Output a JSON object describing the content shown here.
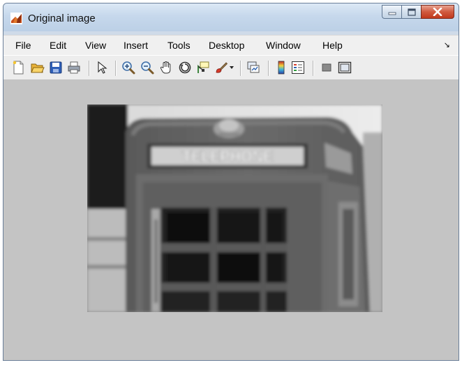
{
  "window": {
    "title": "Original image",
    "accent": "#4a79b8"
  },
  "titlebar_buttons": [
    {
      "name": "minimize-icon"
    },
    {
      "name": "maximize-icon"
    },
    {
      "name": "close-icon"
    }
  ],
  "menu": {
    "items": [
      "File",
      "Edit",
      "View",
      "Insert",
      "Tools",
      "Desktop",
      "Window",
      "Help"
    ],
    "overflow_icon": "chevron-icon"
  },
  "toolbar": {
    "icons": [
      "new-figure-icon",
      "open-file-icon",
      "save-icon",
      "print-icon",
      "pointer-icon",
      "zoom-in-icon",
      "zoom-out-icon",
      "pan-hand-icon",
      "rotate-3d-icon",
      "data-cursor-icon",
      "brush-icon",
      "brush-dropdown-icon",
      "link-plot-icon",
      "colorbar-icon",
      "legend-icon",
      "hide-plot-tools-icon",
      "show-plot-tools-icon"
    ]
  },
  "figure": {
    "background": "#c4c4c4",
    "image_content": "grayscale blurred photo of a red telephone box top",
    "sign_text": "TELEPHONE"
  }
}
